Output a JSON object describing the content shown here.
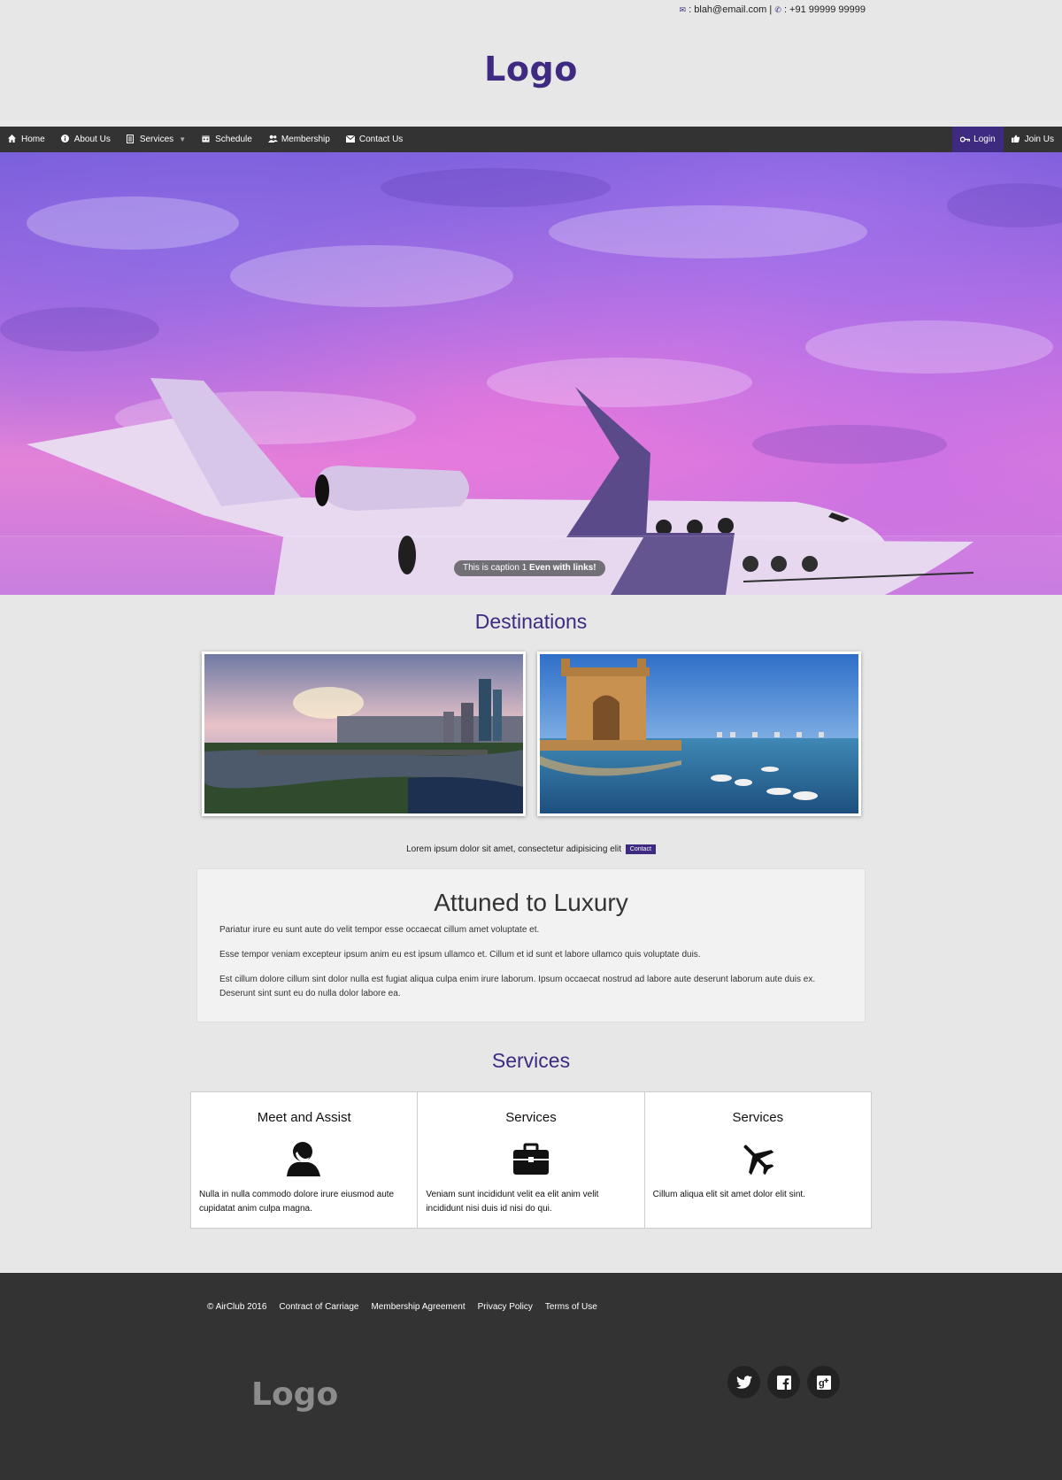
{
  "topbar": {
    "email": ": blah@email.com |",
    "phone": ": +91 99999 99999"
  },
  "header": {
    "logo": "Logo"
  },
  "nav": {
    "left": [
      {
        "label": "Home",
        "icon": "home-icon"
      },
      {
        "label": "About Us",
        "icon": "info-icon"
      },
      {
        "label": "Services",
        "icon": "document-icon"
      },
      {
        "label": "Schedule",
        "icon": "calendar-icon"
      },
      {
        "label": "Membership",
        "icon": "users-icon"
      },
      {
        "label": "Contact Us",
        "icon": "envelope-icon"
      }
    ],
    "right": [
      {
        "label": "Login",
        "icon": "key-icon"
      },
      {
        "label": "Join Us",
        "icon": "thumbs-up-icon"
      }
    ]
  },
  "hero": {
    "caption_text": "This is caption 1",
    "caption_link": "Even with links!"
  },
  "destinations": {
    "title": "Destinations"
  },
  "promo": {
    "text": "Lorem ipsum dolor sit amet, consectetur adipisicing elit",
    "button": "Contact"
  },
  "luxury": {
    "title": "Attuned to Luxury",
    "paragraphs": [
      "Pariatur irure eu sunt aute do velit tempor esse occaecat cillum amet voluptate et.",
      "Esse tempor veniam excepteur ipsum anim eu est ipsum ullamco et. Cillum et id sunt et labore ullamco quis voluptate duis.",
      "Est cillum dolore cillum sint dolor nulla est fugiat aliqua culpa enim irure laborum. Ipsum occaecat nostrud ad labore aute deserunt laborum aute duis ex. Deserunt sint sunt eu do nulla dolor labore ea."
    ]
  },
  "services": {
    "title": "Services",
    "items": [
      {
        "title": "Meet and Assist",
        "icon": "user-icon",
        "text": "Nulla in nulla commodo dolore irure eiusmod aute cupidatat anim culpa magna."
      },
      {
        "title": "Services",
        "icon": "briefcase-icon",
        "text": "Veniam sunt incididunt velit ea elit anim velit incididunt nisi duis id nisi do qui."
      },
      {
        "title": "Services",
        "icon": "airplane-icon",
        "text": "Cillum aliqua elit sit amet dolor elit sint."
      }
    ]
  },
  "footer": {
    "links": [
      "© AirClub 2016",
      "Contract of Carriage",
      "Membership Agreement",
      "Privacy Policy",
      "Terms of Use"
    ],
    "logo": "Logo",
    "social": [
      "twitter-icon",
      "facebook-icon",
      "google-plus-icon"
    ]
  },
  "colors": {
    "brand": "#3e2a80",
    "nav_bg": "#333333",
    "page_bg": "#e7e7e7",
    "footer_bg": "#333333"
  }
}
